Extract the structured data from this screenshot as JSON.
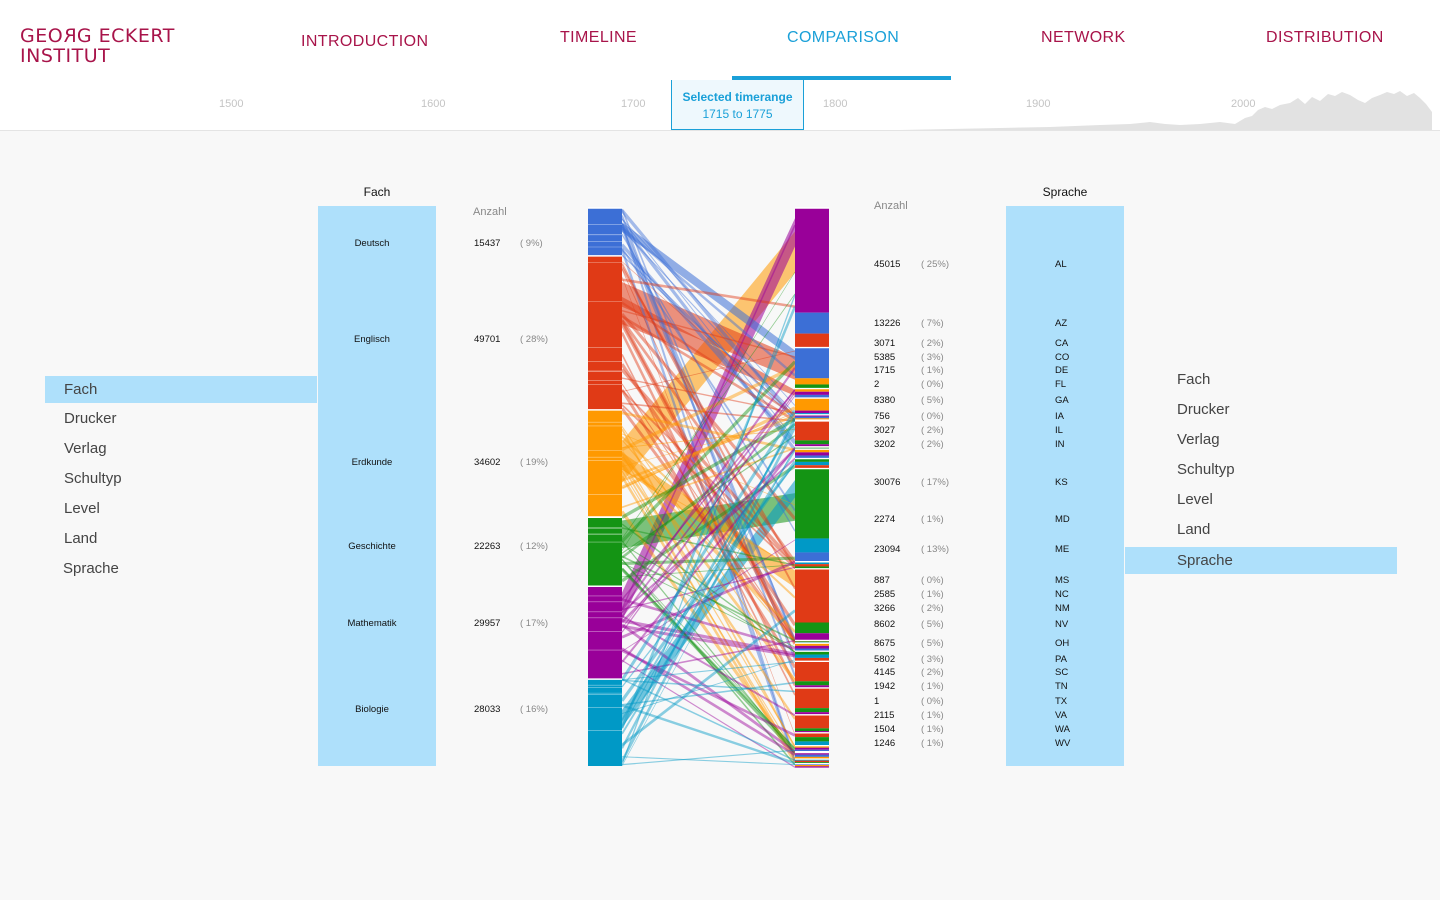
{
  "logo": {
    "line1a": "GEO",
    "line1r": "R",
    "line1b": "G ECKERT",
    "line2": "INSTITUT"
  },
  "nav": [
    {
      "label": "INTRODUCTION",
      "active": false
    },
    {
      "label": "TIMELINE",
      "active": false
    },
    {
      "label": "COMPARISON",
      "active": true
    },
    {
      "label": "NETWORK",
      "active": false
    },
    {
      "label": "DISTRIBUTION",
      "active": false
    }
  ],
  "timeline": {
    "years": [
      "1500",
      "1600",
      "1700",
      "1800",
      "1900",
      "2000"
    ],
    "range_title": "Selected timerange",
    "range_value": "1715 to 1775"
  },
  "left": {
    "dimensions": [
      "Fach",
      "Drucker",
      "Verlag",
      "Schultyp",
      "Level",
      "Land",
      "Sprache"
    ],
    "selected": "Fach",
    "column_title": "Fach",
    "count_header": "Anzahl",
    "categories": [
      {
        "label": "Deutsch",
        "count": "15437",
        "pct": "( 9%)",
        "color": "#3c6fd6"
      },
      {
        "label": "Englisch",
        "count": "49701",
        "pct": "( 28%)",
        "color": "#e03a16"
      },
      {
        "label": "Erdkunde",
        "count": "34602",
        "pct": "( 19%)",
        "color": "#ff9900"
      },
      {
        "label": "Geschichte",
        "count": "22263",
        "pct": "( 12%)",
        "color": "#149414"
      },
      {
        "label": "Mathematik",
        "count": "29957",
        "pct": "( 17%)",
        "color": "#990099"
      },
      {
        "label": "Biologie",
        "count": "28033",
        "pct": "( 16%)",
        "color": "#0099c6"
      }
    ]
  },
  "right": {
    "dimensions": [
      "Fach",
      "Drucker",
      "Verlag",
      "Schultyp",
      "Level",
      "Land",
      "Sprache"
    ],
    "selected": "Sprache",
    "column_title": "Sprache",
    "count_header": "Anzahl",
    "categories": [
      {
        "label": "AL",
        "count": "45015",
        "pct": "( 25%)"
      },
      {
        "label": "AZ",
        "count": "13226",
        "pct": "( 7%)"
      },
      {
        "label": "CA",
        "count": "3071",
        "pct": "( 2%)"
      },
      {
        "label": "CO",
        "count": "5385",
        "pct": "( 3%)"
      },
      {
        "label": "DE",
        "count": "1715",
        "pct": "( 1%)"
      },
      {
        "label": "FL",
        "count": "2",
        "pct": "( 0%)"
      },
      {
        "label": "GA",
        "count": "8380",
        "pct": "( 5%)"
      },
      {
        "label": "IA",
        "count": "756",
        "pct": "( 0%)"
      },
      {
        "label": "IL",
        "count": "3027",
        "pct": "( 2%)"
      },
      {
        "label": "IN",
        "count": "3202",
        "pct": "( 2%)"
      },
      {
        "label": "KS",
        "count": "30076",
        "pct": "( 17%)"
      },
      {
        "label": "MD",
        "count": "2274",
        "pct": "( 1%)"
      },
      {
        "label": "ME",
        "count": "23094",
        "pct": "( 13%)"
      },
      {
        "label": "MS",
        "count": "887",
        "pct": "( 0%)"
      },
      {
        "label": "NC",
        "count": "2585",
        "pct": "( 1%)"
      },
      {
        "label": "NM",
        "count": "3266",
        "pct": "( 2%)"
      },
      {
        "label": "NV",
        "count": "8602",
        "pct": "( 5%)"
      },
      {
        "label": "OH",
        "count": "8675",
        "pct": "( 5%)"
      },
      {
        "label": "PA",
        "count": "5802",
        "pct": "( 3%)"
      },
      {
        "label": "SC",
        "count": "4145",
        "pct": "( 2%)"
      },
      {
        "label": "TN",
        "count": "1942",
        "pct": "( 1%)"
      },
      {
        "label": "TX",
        "count": "1",
        "pct": "( 0%)"
      },
      {
        "label": "VA",
        "count": "2115",
        "pct": "( 1%)"
      },
      {
        "label": "WA",
        "count": "1504",
        "pct": "( 1%)"
      },
      {
        "label": "WV",
        "count": "1246",
        "pct": "( 1%)"
      }
    ]
  }
}
